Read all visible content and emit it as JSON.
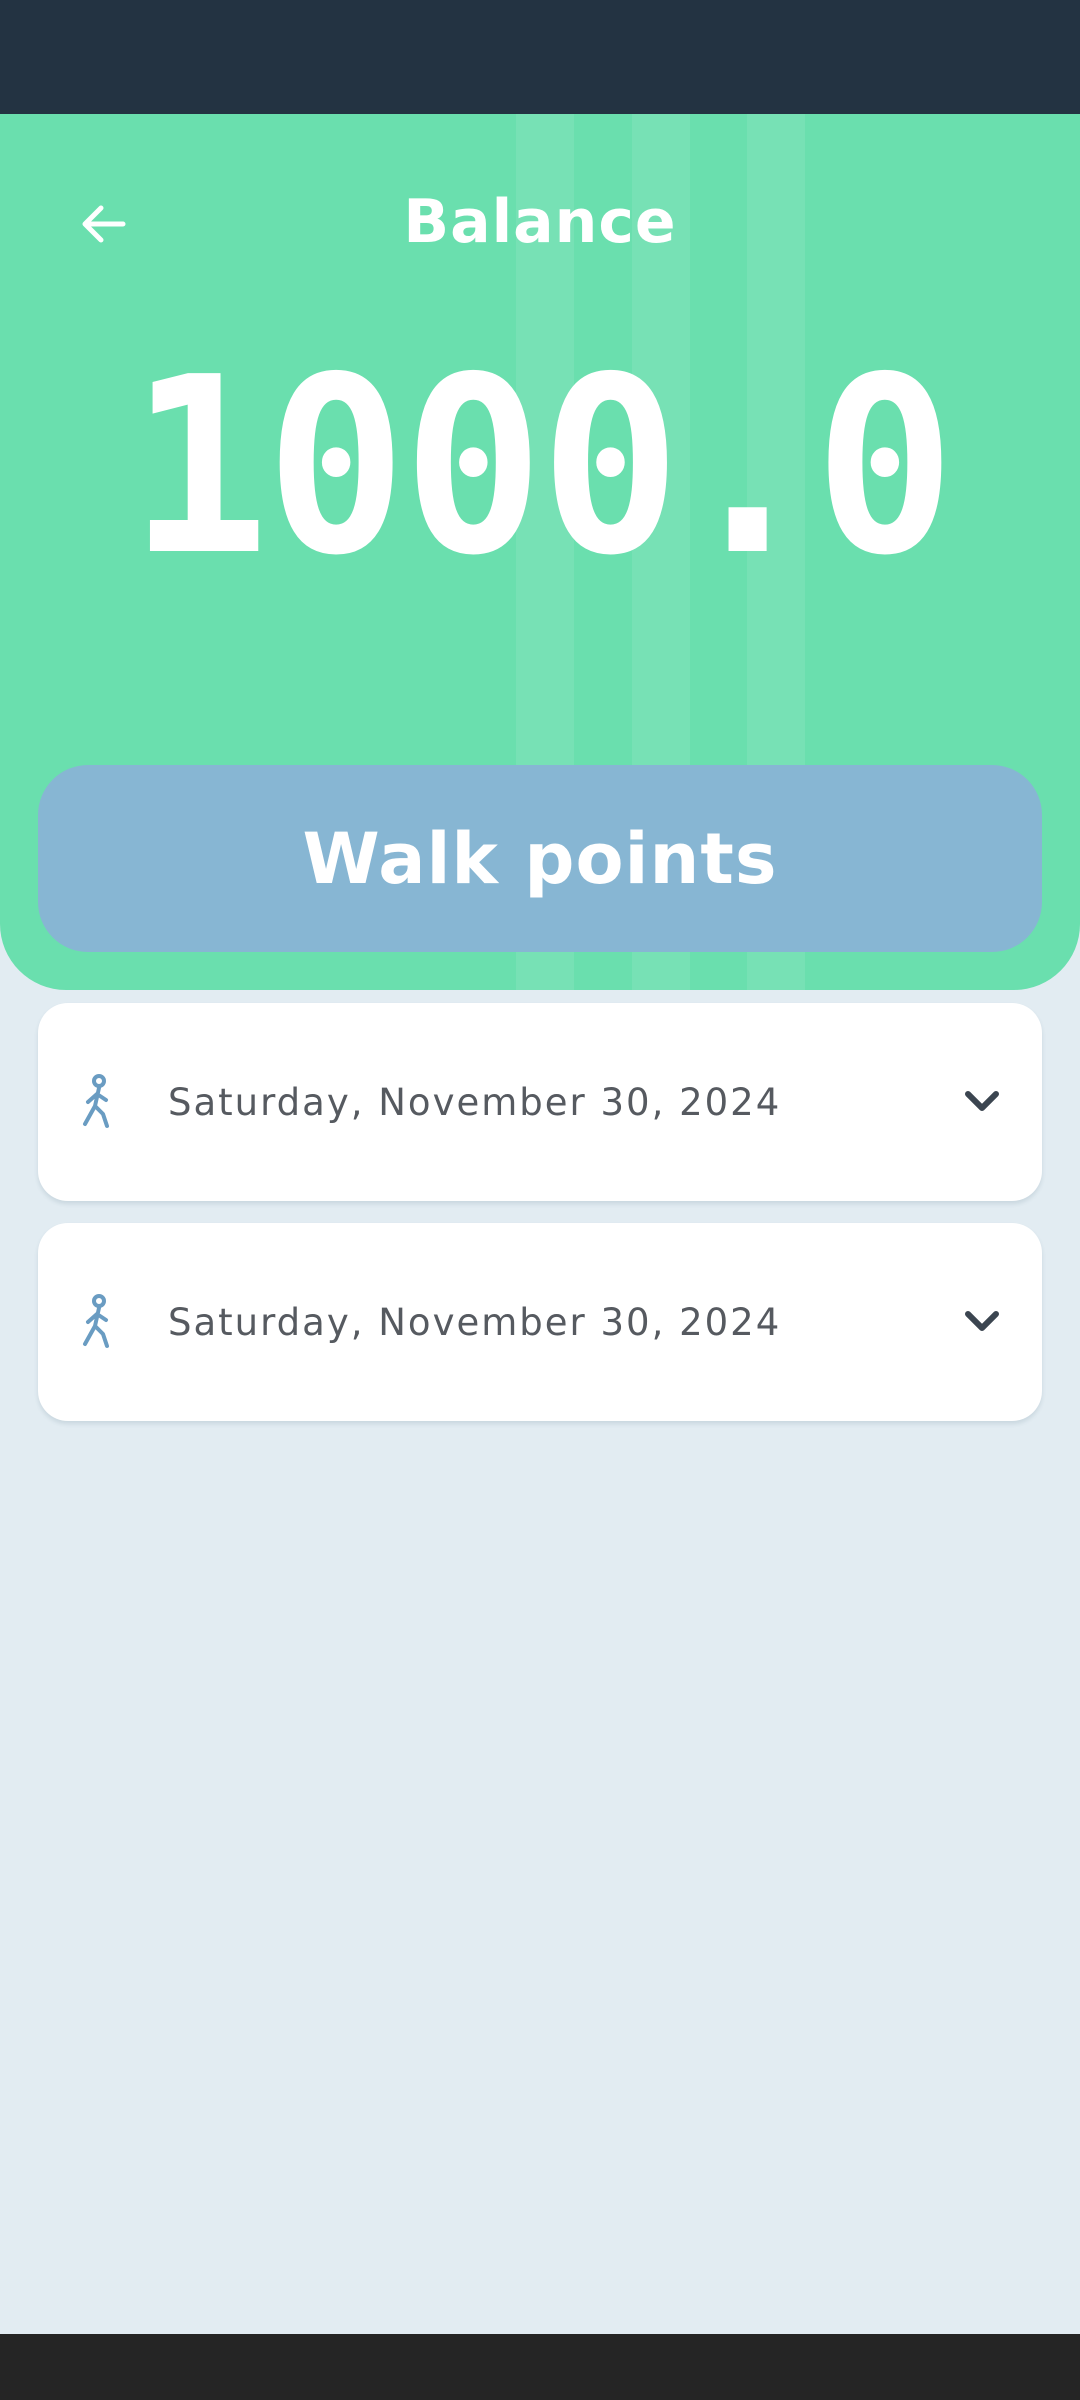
{
  "header": {
    "title": "Balance",
    "back_icon": "arrow-left-icon"
  },
  "balance": {
    "value": "1000.0"
  },
  "walk_points_button": {
    "label": "Walk points"
  },
  "entries": [
    {
      "date": "Saturday, November 30, 2024",
      "icon": "walking-person-icon",
      "toggle_icon": "chevron-down-icon"
    },
    {
      "date": "Saturday, November 30, 2024",
      "icon": "walking-person-icon",
      "toggle_icon": "chevron-down-icon"
    }
  ],
  "colors": {
    "status_bar": "#233342",
    "header_green": "#6adfae",
    "walk_points_blue": "#87b6d3",
    "page_background": "#e2ecf2",
    "card_text": "#565a60",
    "icon_blue": "#6a9cc2",
    "nav_bar": "#252525"
  }
}
